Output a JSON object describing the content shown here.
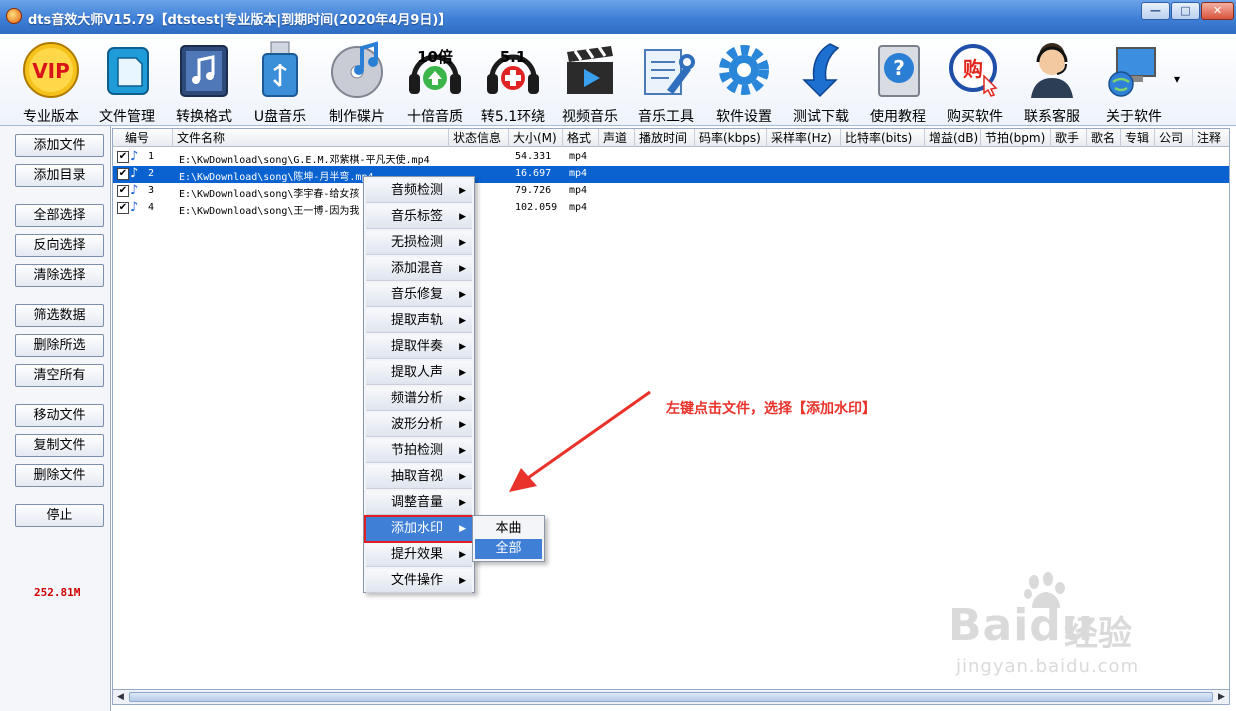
{
  "window": {
    "title": "dts音效大师V15.79【dtstest|专业版本|到期时间(2020年4月9日)】",
    "buttons": [
      "—",
      "□",
      "✕"
    ]
  },
  "toolbar": {
    "items": [
      {
        "label": "专业版本",
        "icon": "vip-icon",
        "badge": "VIP"
      },
      {
        "label": "文件管理",
        "icon": "file-manage-icon"
      },
      {
        "label": "转换格式",
        "icon": "music-note-icon"
      },
      {
        "label": "U盘音乐",
        "icon": "usb-drive-icon"
      },
      {
        "label": "制作碟片",
        "icon": "disc-music-icon"
      },
      {
        "label": "十倍音质",
        "icon": "headphones-10x-icon",
        "badge": "10倍"
      },
      {
        "label": "转5.1环绕",
        "icon": "headphones-51-icon",
        "badge": "5.1"
      },
      {
        "label": "视频音乐",
        "icon": "clapperboard-icon"
      },
      {
        "label": "音乐工具",
        "icon": "tools-icon"
      },
      {
        "label": "软件设置",
        "icon": "gear-icon"
      },
      {
        "label": "测试下载",
        "icon": "download-arrow-icon"
      },
      {
        "label": "使用教程",
        "icon": "help-icon"
      },
      {
        "label": "购买软件",
        "icon": "buy-icon",
        "badge": "购"
      },
      {
        "label": "联系客服",
        "icon": "support-agent-icon"
      },
      {
        "label": "关于软件",
        "icon": "about-computer-icon"
      }
    ],
    "more": "▾"
  },
  "sidebar": {
    "buttons": [
      "添加文件",
      "添加目录",
      "全部选择",
      "反向选择",
      "清除选择",
      "筛选数据",
      "删除所选",
      "清空所有",
      "移动文件",
      "复制文件",
      "删除文件",
      "停止"
    ],
    "size_readout": "252.81M"
  },
  "table": {
    "columns": [
      "编号",
      "文件名称",
      "状态信息",
      "大小(M)",
      "格式",
      "声道",
      "播放时间",
      "码率(kbps)",
      "采样率(Hz)",
      "比特率(bits)",
      "增益(dB)",
      "节拍(bpm)",
      "歌手",
      "歌名",
      "专辑",
      "公司",
      "注释"
    ],
    "rows": [
      {
        "index": "1",
        "path": "E:\\KwDownload\\song\\G.E.M.邓紫棋-平凡天使.mp4",
        "size": "54.331",
        "format": "mp4",
        "checked": true,
        "selected": false
      },
      {
        "index": "2",
        "path": "E:\\KwDownload\\song\\陈坤-月半弯.mp4",
        "size": "16.697",
        "format": "mp4",
        "checked": true,
        "selected": true
      },
      {
        "index": "3",
        "path": "E:\\KwDownload\\song\\李宇春-给女孩",
        "size": "79.726",
        "format": "mp4",
        "checked": true,
        "selected": false
      },
      {
        "index": "4",
        "path": "E:\\KwDownload\\song\\王一博-因为我",
        "size": "102.059",
        "format": "mp4",
        "checked": true,
        "selected": false
      }
    ]
  },
  "context_menu": {
    "items": [
      "音频检测",
      "音乐标签",
      "无损检测",
      "添加混音",
      "音乐修复",
      "提取声轨",
      "提取伴奏",
      "提取人声",
      "频谱分析",
      "波形分析",
      "节拍检测",
      "抽取音视",
      "调整音量",
      "添加水印",
      "提升效果",
      "文件操作"
    ],
    "active_item": "添加水印",
    "submenu": [
      "本曲",
      "全部"
    ],
    "submenu_highlight": "全部"
  },
  "annotation": "左键点击文件，选择【添加水印】",
  "watermark": {
    "brand": "Baidu",
    "cn": "经验",
    "sub": "jingyan.baidu.com"
  },
  "colors": {
    "accent": "#3f7fd6",
    "selection": "#0a62d0",
    "annotation": "#e8322a",
    "readout": "#d00000"
  }
}
